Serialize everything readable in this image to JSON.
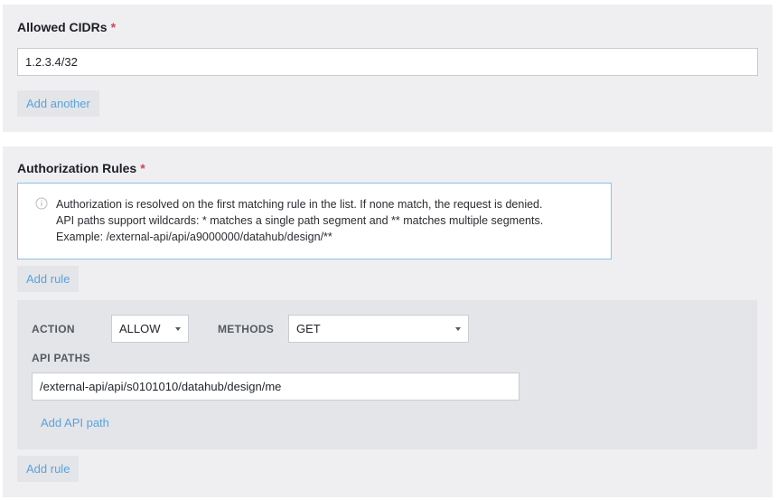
{
  "cidrs": {
    "label": "Allowed CIDRs",
    "required_mark": "*",
    "items": [
      "1.2.3.4/32"
    ],
    "add_another_label": "Add another"
  },
  "authorization": {
    "label": "Authorization Rules",
    "required_mark": "*",
    "info_icon": "info-circle-icon",
    "info_lines": [
      "Authorization is resolved on the first matching rule in the list. If none match, the request is denied.",
      "API paths support wildcards: * matches a single path segment and ** matches multiple segments.",
      "Example: /external-api/api/a9000000/datahub/design/**"
    ],
    "add_rule_label": "Add rule",
    "rules": [
      {
        "action_label": "ACTION",
        "action_value": "ALLOW",
        "methods_label": "METHODS",
        "methods_value": "GET",
        "api_paths_label": "API PATHS",
        "api_paths": [
          "/external-api/api/s0101010/datahub/design/me"
        ],
        "add_api_path_label": "Add API path"
      }
    ],
    "add_rule_bottom_label": "Add rule"
  }
}
